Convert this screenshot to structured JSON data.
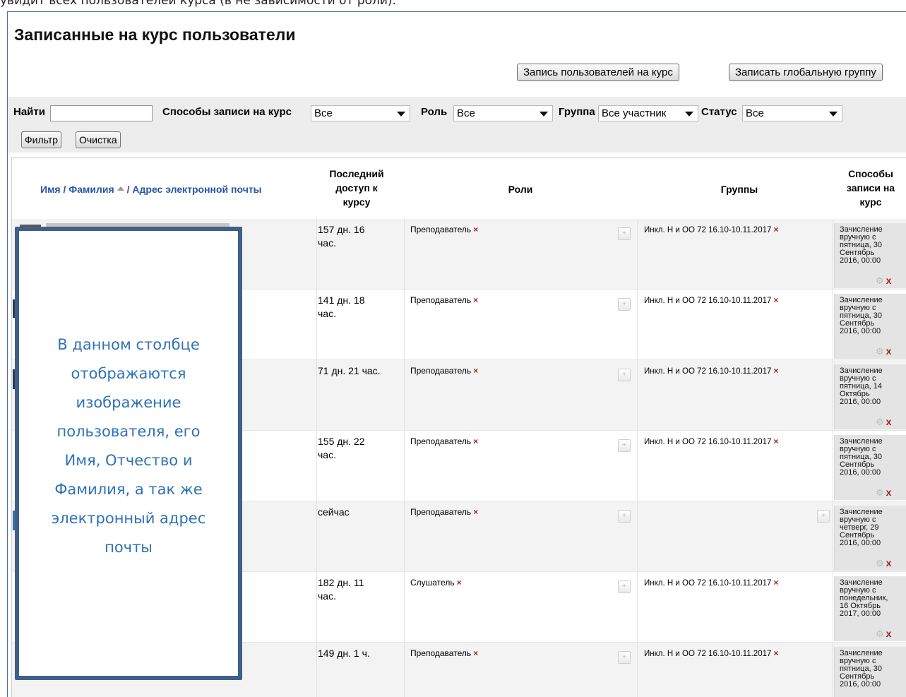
{
  "doc_caption": "увидит всех пользователей курса (в не зависимости от роли).",
  "page": {
    "title": "Записанные на курс пользователи",
    "btn_enrol_users": "Запись пользователей на курс",
    "btn_enrol_cohort": "Записать глобальную группу"
  },
  "filters": {
    "search_label": "Найти",
    "search_value": "",
    "methods_label": "Способы записи на курс",
    "methods_value": "Все",
    "role_label": "Роль",
    "role_value": "Все",
    "group_label": "Группа",
    "group_value": "Все участник",
    "status_label": "Статус",
    "status_value": "Все",
    "filter_button": "Фильтр",
    "clear_button": "Очистка"
  },
  "table": {
    "headers": {
      "name": "Имя / Фамилия",
      "email": "/ Адрес электронной почты",
      "last_access_1": "Последний",
      "last_access_2": "доступ к",
      "last_access_3": "курсу",
      "roles": "Роли",
      "groups": "Группы",
      "methods_1": "Способы",
      "methods_2": "записи на",
      "methods_3": "курс"
    },
    "rows": [
      {
        "access_1": "157 дн. 16",
        "access_2": "час.",
        "role": "Преподаватель",
        "group": "Инкл. Н и ОО 72 16.10-10.11.2017",
        "enrol_1": "Зачисление",
        "enrol_2": "вручную с",
        "enrol_3": "пятница, 30",
        "enrol_4": "Сентябрь",
        "enrol_5": "2016, 00:00"
      },
      {
        "access_1": "141 дн. 18",
        "access_2": "час.",
        "role": "Преподаватель",
        "group": "Инкл. Н и ОО 72 16.10-10.11.2017",
        "enrol_1": "Зачисление",
        "enrol_2": "вручную с",
        "enrol_3": "пятница, 30",
        "enrol_4": "Сентябрь",
        "enrol_5": "2016, 00:00"
      },
      {
        "access_1": "71 дн. 21 час.",
        "access_2": "",
        "role": "Преподаватель",
        "group": "Инкл. Н и ОО 72 16.10-10.11.2017",
        "enrol_1": "Зачисление",
        "enrol_2": "вручную с",
        "enrol_3": "пятница, 14",
        "enrol_4": "Октябрь",
        "enrol_5": "2016, 00:00"
      },
      {
        "access_1": "155 дн. 22",
        "access_2": "час.",
        "role": "Преподаватель",
        "group": "Инкл. Н и ОО 72 16.10-10.11.2017",
        "enrol_1": "Зачисление",
        "enrol_2": "вручную с",
        "enrol_3": "пятница, 30",
        "enrol_4": "Сентябрь",
        "enrol_5": "2016, 00:00"
      },
      {
        "access_1": "сейчас",
        "access_2": "",
        "role": "Преподаватель",
        "group": "",
        "enrol_1": "Зачисление",
        "enrol_2": "вручную с",
        "enrol_3": "четверг, 29",
        "enrol_4": "Сентябрь",
        "enrol_5": "2016, 00:00"
      },
      {
        "access_1": "182 дн. 11",
        "access_2": "час.",
        "role": "Слушатель",
        "group": "Инкл. Н и ОО 72 16.10-10.11.2017",
        "enrol_1": "Зачисление",
        "enrol_2": "вручную с",
        "enrol_3": "понедельник,",
        "enrol_4": "16 Октябрь",
        "enrol_5": "2017, 00:00"
      },
      {
        "access_1": "149 дн. 1 ч.",
        "access_2": "",
        "role": "Преподаватель",
        "group": "Инкл. Н и ОО 72 16.10-10.11.2017",
        "enrol_1": "Зачисление",
        "enrol_2": "вручную с",
        "enrol_3": "пятница, 30",
        "enrol_4": "Сентябрь",
        "enrol_5": "2016, 00:00"
      }
    ],
    "remove_mark": "×",
    "enrol_remove_mark": "x"
  },
  "callout": {
    "line_1": "В данном столбце",
    "line_2": "отображаются",
    "line_3": "изображение",
    "line_4": "пользователя, его",
    "line_5": "Имя, Отчество и",
    "line_6": "Фамилия, а так же",
    "line_7": "электронный адрес",
    "line_8": "почты"
  },
  "colors": {
    "link": "#2a55a3",
    "callout_border": "#3f6089",
    "callout_text": "#2f72b8",
    "remove": "#a5202a"
  }
}
